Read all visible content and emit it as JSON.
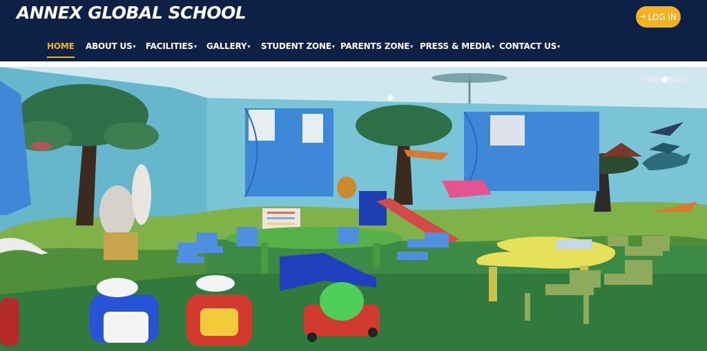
{
  "header": {
    "brand": "ANNEX GLOBAL SCHOOL",
    "login_label": "LOG IN",
    "login_icon": "sign-in-icon",
    "bg_color": "#0d2147",
    "accent_color": "#f4b21f"
  },
  "nav": {
    "items": [
      {
        "label": "HOME",
        "active": true,
        "dropdown": false
      },
      {
        "label": "ABOUT US",
        "active": false,
        "dropdown": true
      },
      {
        "label": "FACILITIES",
        "active": false,
        "dropdown": true
      },
      {
        "label": "GALLERY",
        "active": false,
        "dropdown": true
      },
      {
        "label": "STUDENT ZONE",
        "active": false,
        "dropdown": true
      },
      {
        "label": "PARENTS ZONE",
        "active": false,
        "dropdown": true
      },
      {
        "label": "PRESS & MEDIA",
        "active": false,
        "dropdown": true
      },
      {
        "label": "CONTACT US",
        "active": false,
        "dropdown": true
      }
    ],
    "dropdown_glyph": "▾"
  },
  "hero": {
    "palette": {
      "wall": "#5fb3c9",
      "floor": "#2f7a3c",
      "curtain": "#3f88d8",
      "table_green": "#58b04a",
      "table_yellow": "#e7e05a"
    }
  }
}
